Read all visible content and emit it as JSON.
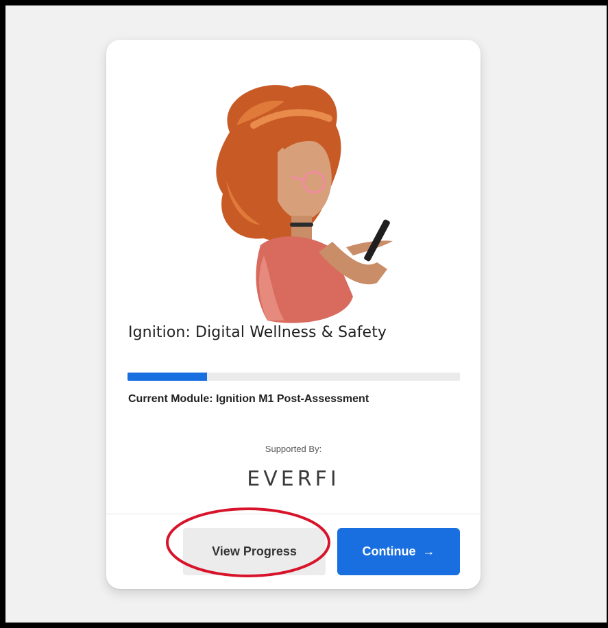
{
  "card": {
    "title": "Ignition: Digital Wellness & Safety",
    "progress_fraction": 0.24,
    "current_module": "Current Module: Ignition M1 Post-Assessment",
    "supported_by": "Supported By:",
    "logo_text": "EVERFI"
  },
  "actions": {
    "view_progress": "View Progress",
    "continue": "Continue",
    "continue_icon": "arrow-right-icon"
  },
  "colors": {
    "accent": "#1a6fe0",
    "annotation": "#d7142a"
  },
  "illustration": "girl-with-phone-illustration"
}
